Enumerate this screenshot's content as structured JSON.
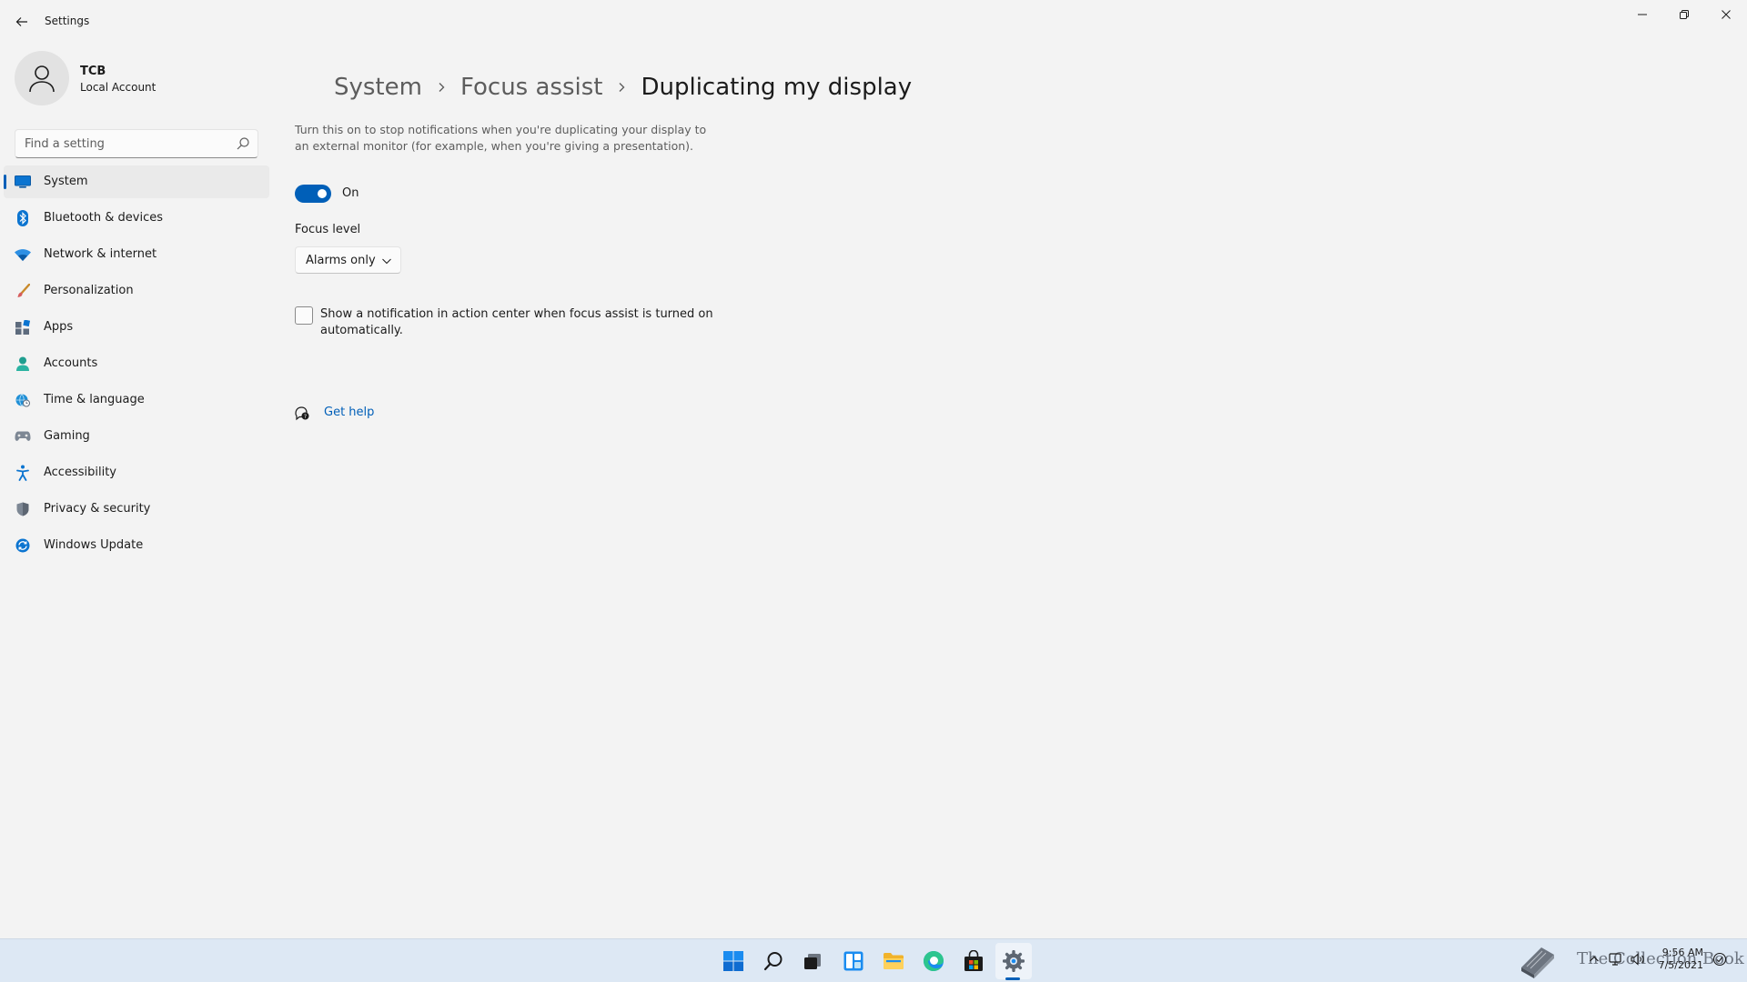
{
  "window": {
    "title": "Settings"
  },
  "profile": {
    "name": "TCB",
    "account_type": "Local Account"
  },
  "search": {
    "placeholder": "Find a setting"
  },
  "sidebar": {
    "items": [
      {
        "label": "System",
        "icon": "system-icon",
        "active": true
      },
      {
        "label": "Bluetooth & devices",
        "icon": "bluetooth-icon"
      },
      {
        "label": "Network & internet",
        "icon": "network-icon"
      },
      {
        "label": "Personalization",
        "icon": "brush-icon"
      },
      {
        "label": "Apps",
        "icon": "apps-icon"
      },
      {
        "label": "Accounts",
        "icon": "person-icon"
      },
      {
        "label": "Time & language",
        "icon": "globe-clock-icon"
      },
      {
        "label": "Gaming",
        "icon": "gamepad-icon"
      },
      {
        "label": "Accessibility",
        "icon": "accessibility-icon"
      },
      {
        "label": "Privacy & security",
        "icon": "shield-icon"
      },
      {
        "label": "Windows Update",
        "icon": "update-icon"
      }
    ]
  },
  "breadcrumb": {
    "items": [
      "System",
      "Focus assist",
      "Duplicating my display"
    ]
  },
  "main": {
    "description": "Turn this on to stop notifications when you're duplicating your display to an external monitor (for example, when you're giving a presentation).",
    "toggle_state": "On",
    "focus_level_label": "Focus level",
    "focus_level_value": "Alarms only",
    "checkbox_label": "Show a notification in action center when focus assist is turned on automatically.",
    "help_link": "Get help"
  },
  "taskbar": {
    "watermark_text": "The Collection Book",
    "clock_time": "9:56 AM",
    "clock_date": "7/5/2021"
  },
  "colors": {
    "accent": "#005fb8",
    "background": "#f3f3f3",
    "taskbar": "#dde8f4"
  }
}
